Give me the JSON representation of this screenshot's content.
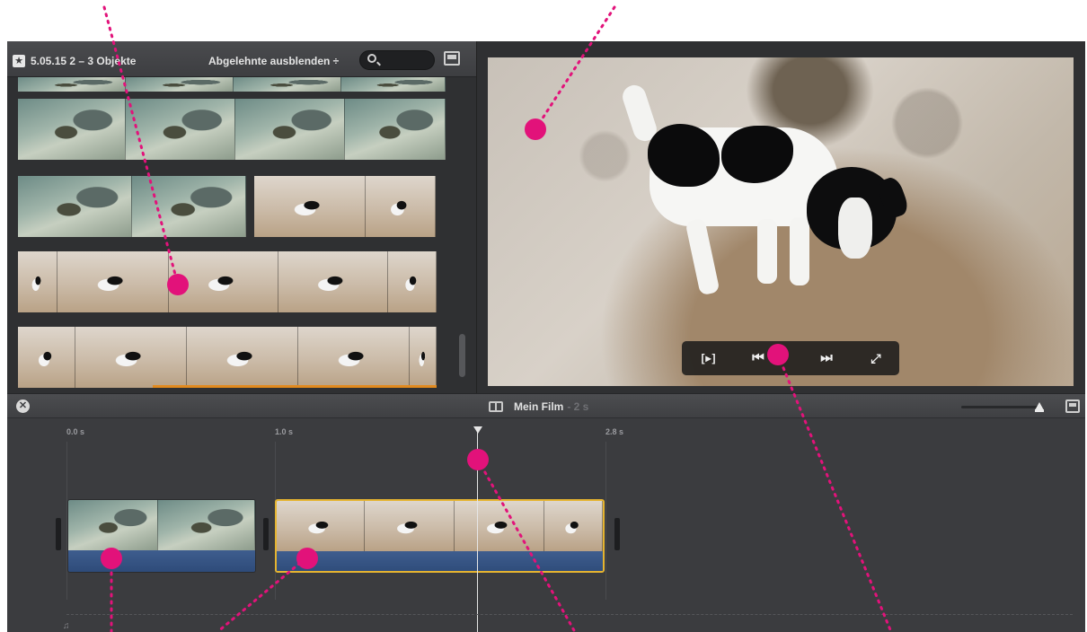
{
  "browser": {
    "event_title": "5.05.15 2 – 3 Objekte",
    "reject_filter_label": "Abgelehnte ausblenden ÷",
    "search": {
      "value": "",
      "placeholder": ""
    },
    "icons": {
      "event": "star-icon",
      "search": "search-icon",
      "toggle": "browser-toggle-icon"
    }
  },
  "viewer": {
    "transport": {
      "play_selection": "[▸]",
      "skip_back": "⏮",
      "skip_forward": "⏭",
      "fullscreen": "⤢"
    }
  },
  "timeline": {
    "close_glyph": "✕",
    "project_title": "Mein Film",
    "project_duration": "- 2 s",
    "ticks": [
      "0.0 s",
      "1.0 s",
      "2.8 s"
    ],
    "music_glyph": "♫"
  },
  "colors": {
    "callout": "#e2127a",
    "selected_clip_border": "#e5b430",
    "audio_track": "#2d4a78",
    "range_marker": "#e28a1e"
  }
}
